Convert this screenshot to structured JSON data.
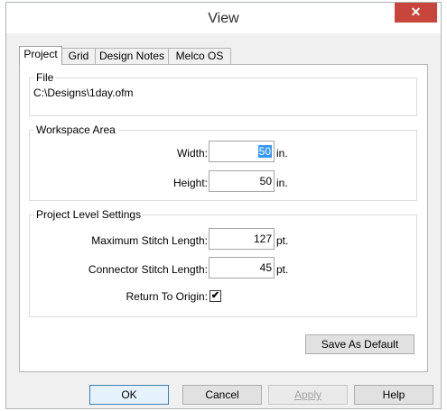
{
  "window": {
    "title": "View",
    "close_glyph": "✕"
  },
  "tabs": [
    {
      "label": "Project"
    },
    {
      "label": "Grid"
    },
    {
      "label": "Design Notes"
    },
    {
      "label": "Melco OS"
    }
  ],
  "file": {
    "group_title": "File",
    "path": "C:\\Designs\\1day.ofm"
  },
  "workspace": {
    "group_title": "Workspace Area",
    "width_label": "Width:",
    "width_value": "50",
    "width_unit": "in.",
    "height_label": "Height:",
    "height_value": "50",
    "height_unit": "in."
  },
  "project_settings": {
    "group_title": "Project Level Settings",
    "max_stitch_label": "Maximum Stitch Length:",
    "max_stitch_value": "127",
    "max_stitch_unit": "pt.",
    "connector_label": "Connector Stitch Length:",
    "connector_value": "45",
    "connector_unit": "pt.",
    "return_label": "Return To Origin:",
    "return_checked_glyph": "✔"
  },
  "buttons": {
    "save_default": "Save As Default",
    "ok": "OK",
    "cancel": "Cancel",
    "apply": "Apply",
    "help": "Help"
  },
  "colors": {
    "close_button": "#c7453b",
    "selection": "#3399ff"
  }
}
